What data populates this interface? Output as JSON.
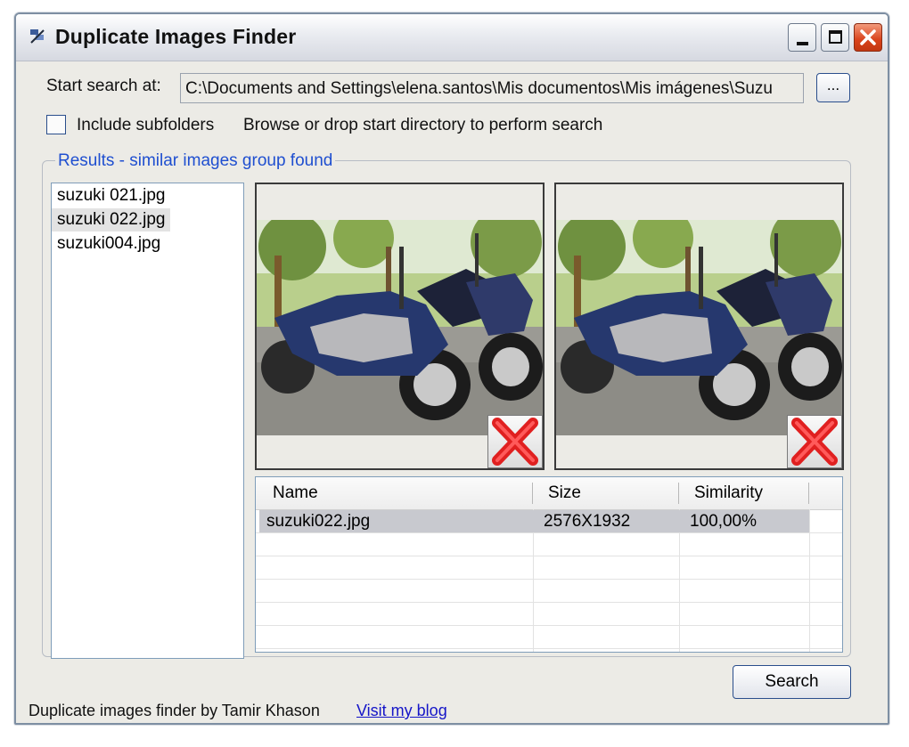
{
  "window": {
    "title": "Duplicate Images Finder",
    "controls": [
      "minimize",
      "maximize",
      "close"
    ],
    "app_icon": "magnifier-app-icon"
  },
  "search": {
    "label": "Start search at:",
    "path": "C:\\Documents and Settings\\elena.santos\\Mis documentos\\Mis imágenes\\Suzu",
    "browse_label": "..."
  },
  "options": {
    "include_subfolders_label": "Include subfolders",
    "include_subfolders_checked": false,
    "hint": "Browse or drop start directory to perform search"
  },
  "results": {
    "group_title": "Results - similar images group found",
    "files": [
      "suzuki 021.jpg",
      "suzuki 022.jpg",
      "suzuki004.jpg"
    ],
    "selected_index": 1
  },
  "previews": [
    {
      "name": "left-preview",
      "delete_icon": "red-x-icon"
    },
    {
      "name": "right-preview",
      "delete_icon": "red-x-icon"
    }
  ],
  "grid": {
    "columns": [
      "Name",
      "Size",
      "Similarity"
    ],
    "rows": [
      {
        "name": "suzuki022.jpg",
        "size": "2576X1932",
        "similarity": "100,00%"
      }
    ]
  },
  "buttons": {
    "search_label": "Search"
  },
  "footer": {
    "credit": "Duplicate images finder by Tamir Khason",
    "link": "Visit my blog"
  },
  "colors": {
    "accent": "#1f4fd0",
    "link": "#1515c8",
    "close_button": "#d9421b",
    "delete_x": "#e02020"
  }
}
